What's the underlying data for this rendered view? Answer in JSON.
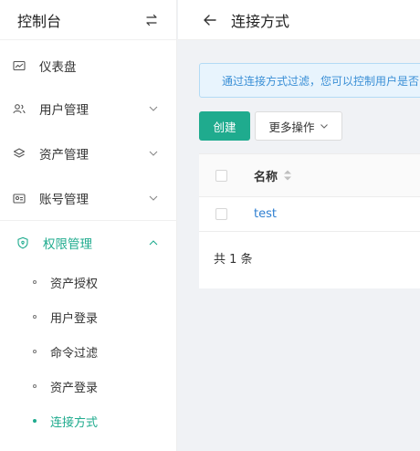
{
  "sidebar": {
    "title": "控制台",
    "menu": [
      {
        "label": "仪表盘",
        "icon": "dashboard-icon"
      },
      {
        "label": "用户管理",
        "icon": "users-icon"
      },
      {
        "label": "资产管理",
        "icon": "layers-icon"
      },
      {
        "label": "账号管理",
        "icon": "account-icon"
      },
      {
        "label": "权限管理",
        "icon": "shield-icon"
      }
    ],
    "submenu": [
      {
        "label": "资产授权"
      },
      {
        "label": "用户登录"
      },
      {
        "label": "命令过滤"
      },
      {
        "label": "资产登录"
      },
      {
        "label": "连接方式"
      }
    ]
  },
  "header": {
    "title": "连接方式"
  },
  "alert": {
    "text": "通过连接方式过滤，您可以控制用户是否"
  },
  "toolbar": {
    "create_label": "创建",
    "more_label": "更多操作"
  },
  "table": {
    "columns": [
      "名称"
    ],
    "rows": [
      {
        "name": "test"
      }
    ],
    "total": "共 1 条"
  },
  "colors": {
    "accent": "#1fab8e",
    "link": "#2f7fd1",
    "alert_bg": "#e8f4fd"
  }
}
